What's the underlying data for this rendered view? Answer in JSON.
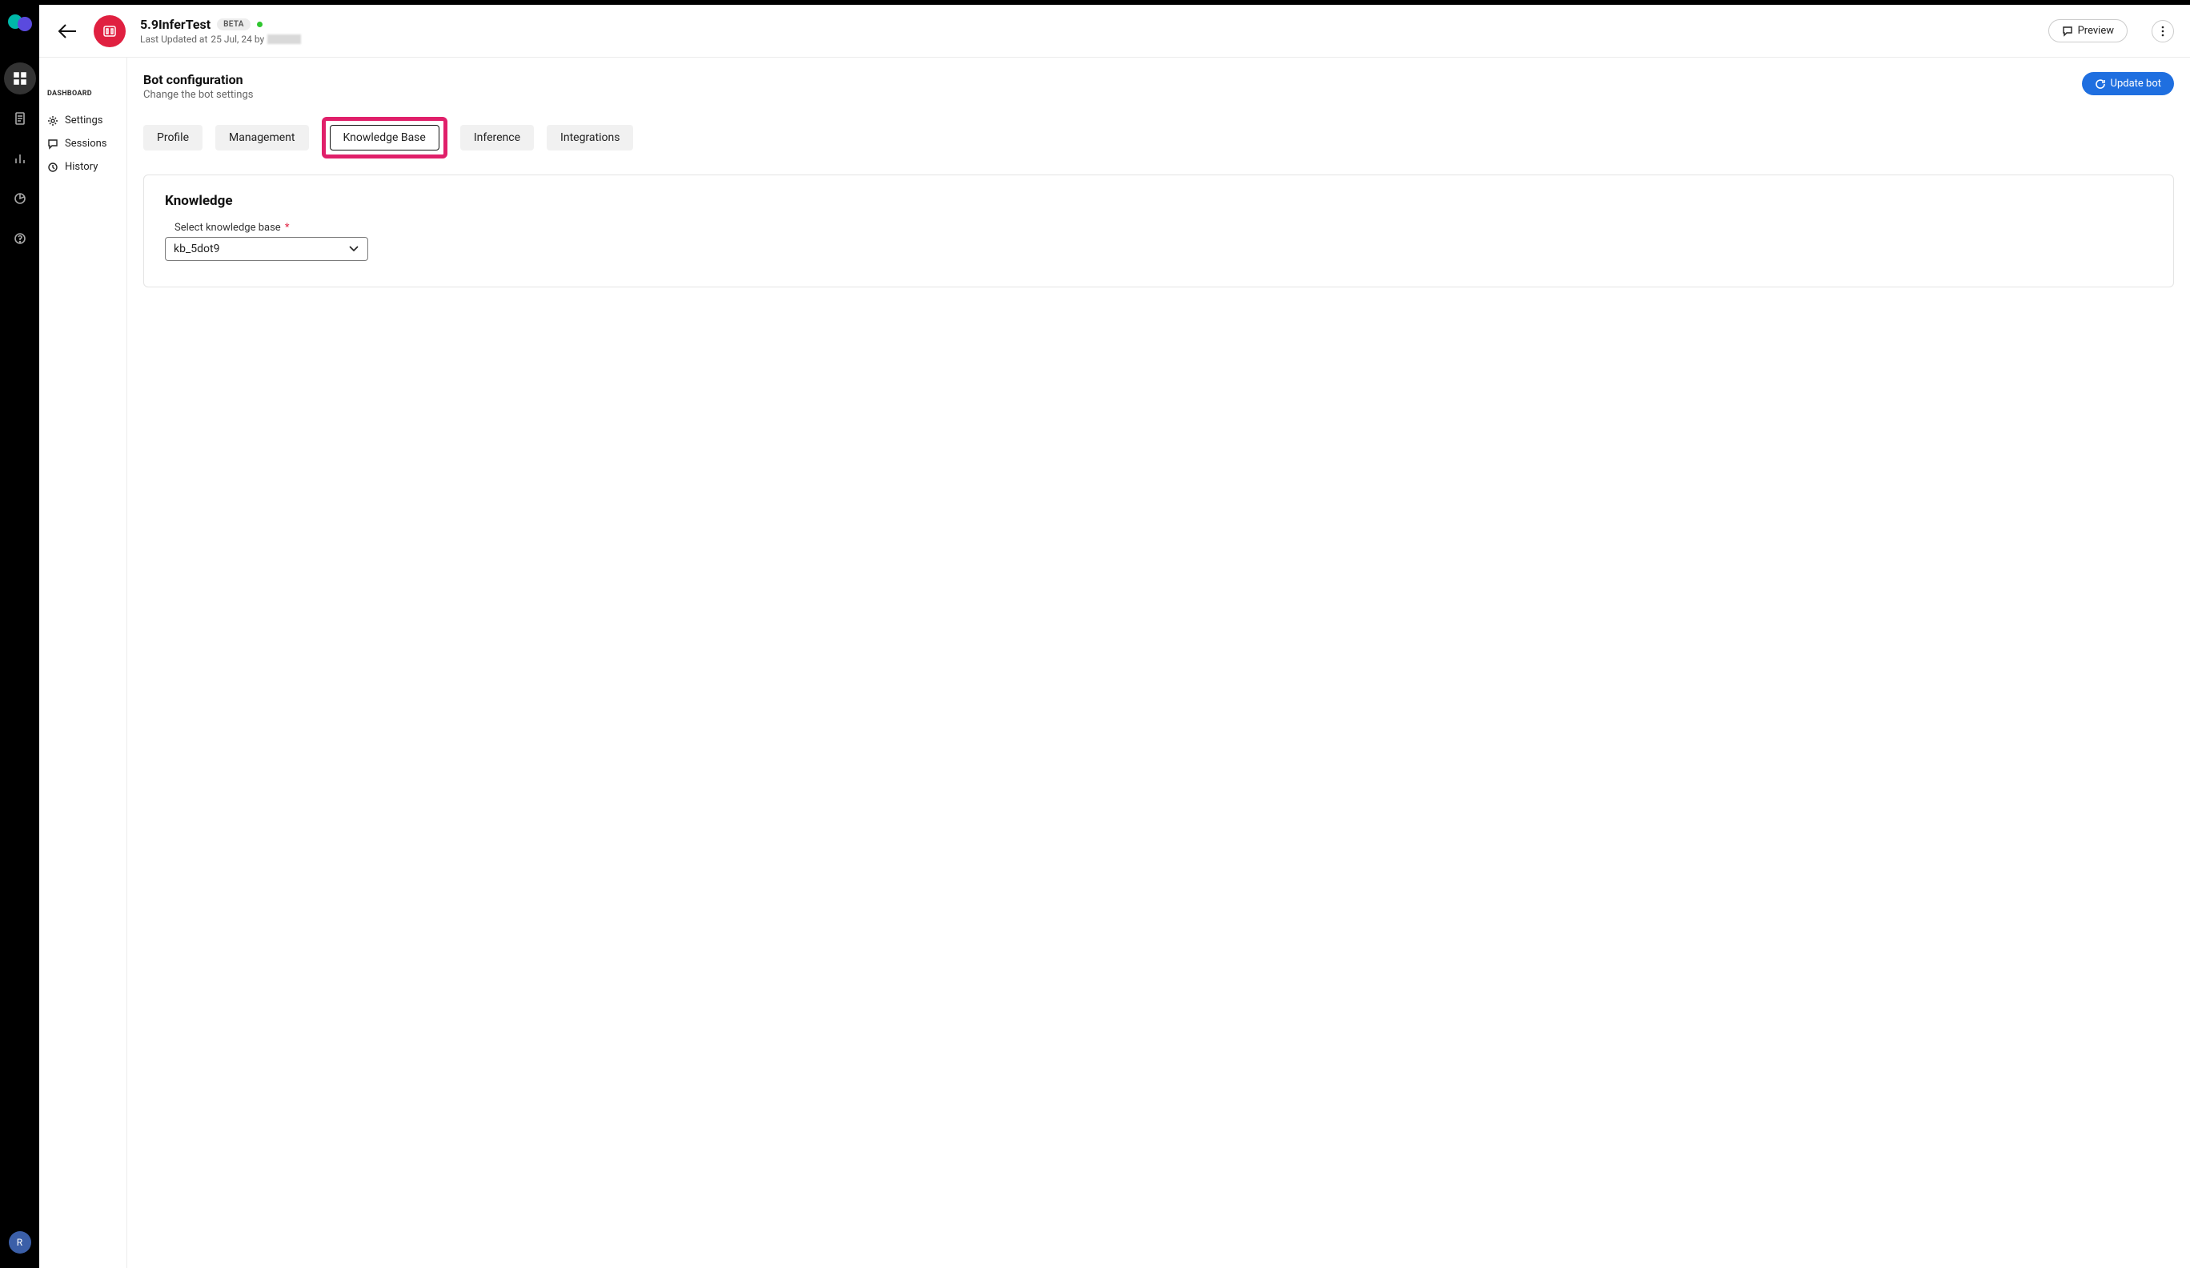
{
  "rail": {
    "avatar_initial": "R"
  },
  "header": {
    "bot_name": "5.9InferTest",
    "beta_label": "BETA",
    "updated_prefix": "Last Updated at",
    "updated_date": "25 Jul, 24 by",
    "preview_label": "Preview"
  },
  "sidebar": {
    "heading": "DASHBOARD",
    "items": [
      {
        "label": "Settings"
      },
      {
        "label": "Sessions"
      },
      {
        "label": "History"
      }
    ]
  },
  "config": {
    "title": "Bot configuration",
    "subtitle": "Change the bot settings",
    "update_label": "Update bot"
  },
  "tabs": [
    {
      "label": "Profile"
    },
    {
      "label": "Management"
    },
    {
      "label": "Knowledge Base"
    },
    {
      "label": "Inference"
    },
    {
      "label": "Integrations"
    }
  ],
  "card": {
    "title": "Knowledge",
    "field_label": "Select knowledge base",
    "required_mark": "*",
    "selected": "kb_5dot9"
  }
}
